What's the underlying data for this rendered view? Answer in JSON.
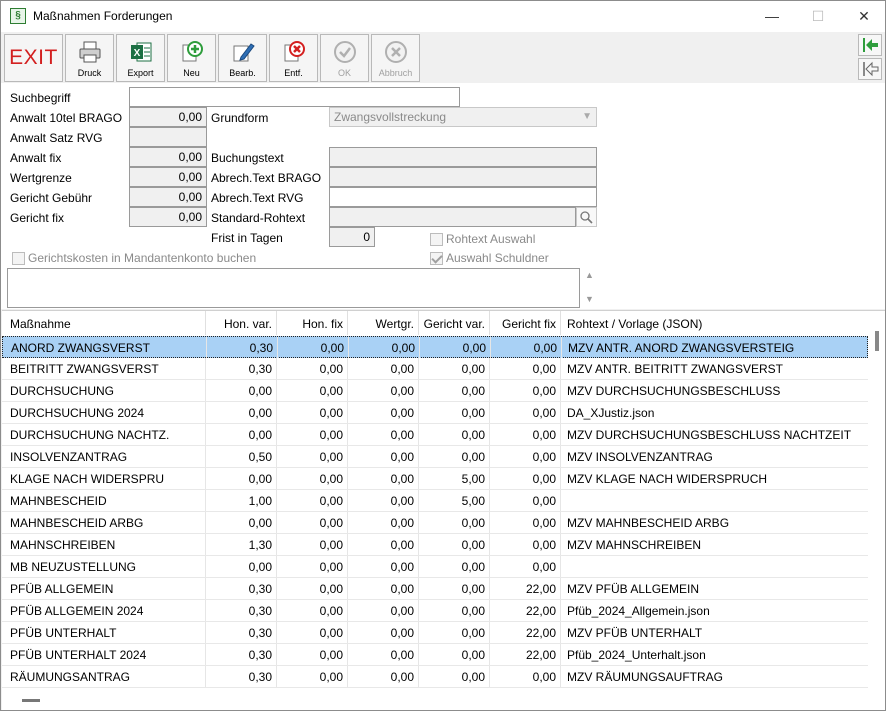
{
  "window": {
    "title": "Maßnahmen Forderungen",
    "minimize": "—",
    "maximize": "☐",
    "close": "✕"
  },
  "toolbar": {
    "exit": "EXIT",
    "druck": "Druck",
    "export": "Export",
    "neu": "Neu",
    "bearb": "Bearb.",
    "entf": "Entf.",
    "ok": "OK",
    "abbruch": "Abbruch"
  },
  "form": {
    "suchbegriff_label": "Suchbegriff",
    "suchbegriff_value": "",
    "anwalt10_label": "Anwalt 10tel BRAGO",
    "anwalt10_value": "0,00",
    "anwaltsatz_label": "Anwalt Satz RVG",
    "anwaltsatz_value": "",
    "anwaltfix_label": "Anwalt fix",
    "anwaltfix_value": "0,00",
    "wertgrenze_label": "Wertgrenze",
    "wertgrenze_value": "0,00",
    "gerichtgebuehr_label": "Gericht Gebühr",
    "gerichtgebuehr_value": "0,00",
    "gerichtfix_label": "Gericht fix",
    "gerichtfix_value": "0,00",
    "grundform_label": "Grundform",
    "grundform_value": "Zwangsvollstreckung",
    "buchungstext_label": "Buchungstext",
    "buchungstext_value": "",
    "abrech_brago_label": "Abrech.Text BRAGO",
    "abrech_brago_value": "",
    "abrech_rvg_label": "Abrech.Text RVG",
    "abrech_rvg_value": "",
    "standard_rohtext_label": "Standard-Rohtext",
    "standard_rohtext_value": "",
    "frist_label": "Frist in Tagen",
    "frist_value": "0",
    "rohtext_auswahl_label": "Rohtext Auswahl",
    "auswahl_schuldner_label": "Auswahl Schuldner",
    "gerichtskosten_label": "Gerichtskosten in Mandantenkonto buchen"
  },
  "table": {
    "headers": [
      "Maßnahme",
      "Hon. var.",
      "Hon. fix",
      "Wertgr.",
      "Gericht var.",
      "Gericht fix",
      "Rohtext / Vorlage (JSON)"
    ],
    "rows": [
      [
        "ANORD ZWANGSVERST",
        "0,30",
        "0,00",
        "0,00",
        "0,00",
        "0,00",
        "MZV ANTR. ANORD ZWANGSVERSTEIG"
      ],
      [
        "BEITRITT ZWANGSVERST",
        "0,30",
        "0,00",
        "0,00",
        "0,00",
        "0,00",
        "MZV ANTR. BEITRITT ZWANGSVERST"
      ],
      [
        "DURCHSUCHUNG",
        "0,00",
        "0,00",
        "0,00",
        "0,00",
        "0,00",
        "MZV DURCHSUCHUNGSBESCHLUSS"
      ],
      [
        "DURCHSUCHUNG 2024",
        "0,00",
        "0,00",
        "0,00",
        "0,00",
        "0,00",
        "DA_XJustiz.json"
      ],
      [
        "DURCHSUCHUNG NACHTZ.",
        "0,00",
        "0,00",
        "0,00",
        "0,00",
        "0,00",
        "MZV DURCHSUCHUNGSBESCHLUSS NACHTZEIT"
      ],
      [
        "INSOLVENZANTRAG",
        "0,50",
        "0,00",
        "0,00",
        "0,00",
        "0,00",
        "MZV INSOLVENZANTRAG"
      ],
      [
        "KLAGE NACH WIDERSPRU",
        "0,00",
        "0,00",
        "0,00",
        "5,00",
        "0,00",
        "MZV KLAGE NACH WIDERSPRUCH"
      ],
      [
        "MAHNBESCHEID",
        "1,00",
        "0,00",
        "0,00",
        "5,00",
        "0,00",
        ""
      ],
      [
        "MAHNBESCHEID ARBG",
        "0,00",
        "0,00",
        "0,00",
        "0,00",
        "0,00",
        "MZV MAHNBESCHEID ARBG"
      ],
      [
        "MAHNSCHREIBEN",
        "1,30",
        "0,00",
        "0,00",
        "0,00",
        "0,00",
        "MZV MAHNSCHREIBEN"
      ],
      [
        "MB NEUZUSTELLUNG",
        "0,00",
        "0,00",
        "0,00",
        "0,00",
        "0,00",
        ""
      ],
      [
        "PFÜB ALLGEMEIN",
        "0,30",
        "0,00",
        "0,00",
        "0,00",
        "22,00",
        "MZV PFÜB ALLGEMEIN"
      ],
      [
        "PFÜB ALLGEMEIN 2024",
        "0,30",
        "0,00",
        "0,00",
        "0,00",
        "22,00",
        "Pfüb_2024_Allgemein.json"
      ],
      [
        "PFÜB UNTERHALT",
        "0,30",
        "0,00",
        "0,00",
        "0,00",
        "22,00",
        "MZV PFÜB UNTERHALT"
      ],
      [
        "PFÜB UNTERHALT 2024",
        "0,30",
        "0,00",
        "0,00",
        "0,00",
        "22,00",
        "Pfüb_2024_Unterhalt.json"
      ],
      [
        "RÄUMUNGSANTRAG",
        "0,30",
        "0,00",
        "0,00",
        "0,00",
        "0,00",
        "MZV RÄUMUNGSAUFTRAG"
      ]
    ]
  }
}
